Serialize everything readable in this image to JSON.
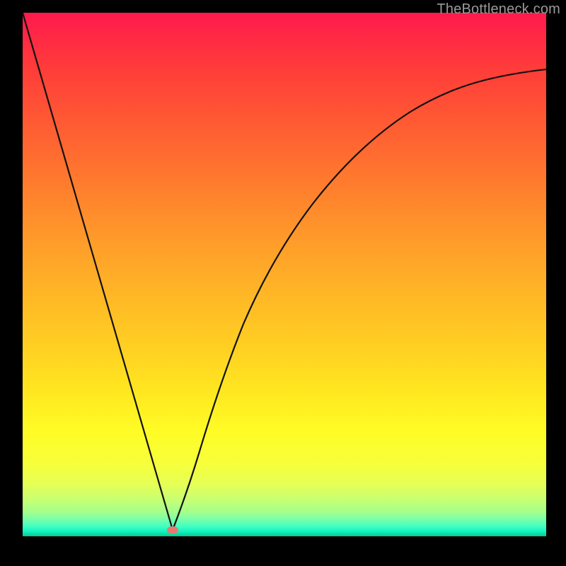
{
  "watermark": "TheBottleneck.com",
  "colors": {
    "curve_stroke": "#111111",
    "marker_fill": "#e9786f",
    "background": "#000000"
  },
  "marker": {
    "x_frac": 0.287,
    "y_frac": 0.988
  },
  "chart_data": {
    "type": "line",
    "title": "",
    "xlabel": "",
    "ylabel": "",
    "xlim": [
      0,
      1
    ],
    "ylim": [
      0,
      1
    ],
    "x": [
      0.0,
      0.02,
      0.05,
      0.08,
      0.11,
      0.14,
      0.17,
      0.2,
      0.23,
      0.26,
      0.287,
      0.31,
      0.33,
      0.35,
      0.38,
      0.41,
      0.44,
      0.48,
      0.52,
      0.57,
      0.62,
      0.68,
      0.74,
      0.8,
      0.86,
      0.92,
      1.0
    ],
    "y": [
      1.0,
      0.93,
      0.83,
      0.72,
      0.62,
      0.51,
      0.41,
      0.3,
      0.2,
      0.09,
      0.0,
      0.07,
      0.15,
      0.22,
      0.32,
      0.41,
      0.49,
      0.57,
      0.64,
      0.7,
      0.74,
      0.78,
      0.81,
      0.84,
      0.86,
      0.87,
      0.89
    ],
    "series": [
      {
        "name": "curve",
        "values_ref": "y"
      }
    ],
    "annotations": [
      {
        "type": "marker",
        "x": 0.287,
        "y": 0.012,
        "label": ""
      }
    ]
  }
}
